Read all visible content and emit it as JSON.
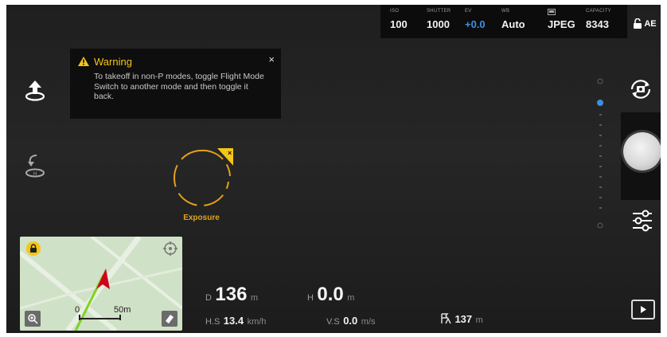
{
  "camera": {
    "iso": {
      "label": "ISO",
      "value": "100"
    },
    "shutter": {
      "label": "SHUTTER",
      "value": "1000"
    },
    "ev": {
      "label": "EV",
      "value": "+0.0"
    },
    "wb": {
      "label": "WB",
      "value": "Auto"
    },
    "format": {
      "value": "JPEG"
    },
    "capacity": {
      "label": "CAPACITY",
      "value": "8343"
    },
    "ae": "AE"
  },
  "warning": {
    "title": "Warning",
    "message": "To takeoff in non-P modes, toggle Flight Mode Switch to another mode and then toggle it back.",
    "close": "×"
  },
  "exposure": {
    "label": "Exposure"
  },
  "map": {
    "scale_start": "0",
    "scale_end": "50m"
  },
  "telemetry": {
    "distance": {
      "key": "D",
      "value": "136",
      "unit": "m"
    },
    "height": {
      "key": "H",
      "value": "0.0",
      "unit": "m"
    },
    "hspeed": {
      "key": "H.S",
      "value": "13.4",
      "unit": "km/h"
    },
    "vspeed": {
      "key": "V.S",
      "value": "0.0",
      "unit": "m/s"
    },
    "home": {
      "value": "137",
      "unit": "m"
    }
  },
  "colors": {
    "accent": "#f5c518",
    "exposure": "#e3a21a",
    "ev": "#3d8fe0"
  },
  "icons": [
    "takeoff-icon",
    "return-home-icon",
    "camera-switch-icon",
    "shutter-button",
    "settings-sliders-icon",
    "playback-icon",
    "lock-icon",
    "compass-icon",
    "zoom-icon",
    "eraser-icon"
  ]
}
